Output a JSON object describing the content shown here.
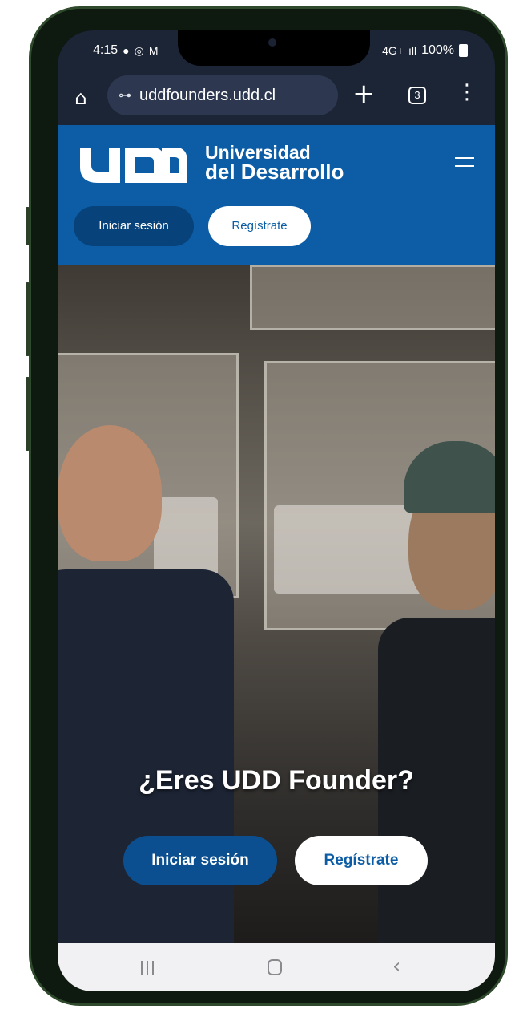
{
  "status_bar": {
    "time": "4:15",
    "left_icons": [
      "chat-bubble-icon",
      "whatsapp-icon",
      "gmail-icon",
      "signal-dot-icon"
    ],
    "network": "4G+",
    "signal": "ıll",
    "battery": "100%"
  },
  "browser": {
    "url": "uddfounders.udd.cl",
    "tabs_count": "3",
    "plus_label": "+",
    "menu_label": "⋮",
    "home_label": "⌂",
    "tune_label": "⊶"
  },
  "header": {
    "logo_mark": "UDD",
    "logo_line1": "Universidad",
    "logo_line2": "del Desarrollo",
    "login_label": "Iniciar sesión",
    "register_label": "Regístrate",
    "colors": {
      "brand": "#0c5da5",
      "brand_dark": "#08427a"
    }
  },
  "hero": {
    "title": "¿Eres UDD Founder?",
    "login_label": "Iniciar sesión",
    "register_label": "Regístrate"
  },
  "nav": {
    "back_label": "‹"
  }
}
